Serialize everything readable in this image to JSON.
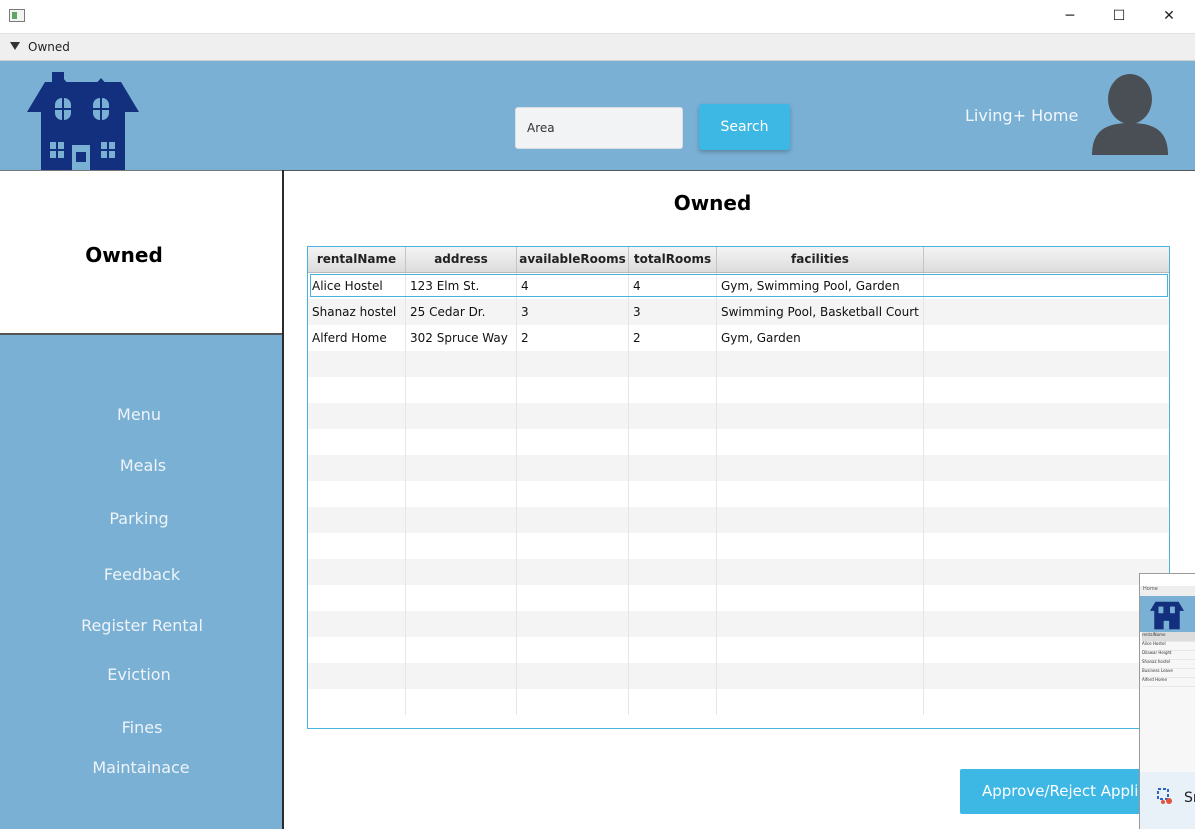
{
  "window": {
    "title": "Owned",
    "controls": {
      "minimize": "─",
      "maximize": "☐",
      "close": "✕"
    }
  },
  "search": {
    "value": "Area",
    "button_label": "Search"
  },
  "brand": "Living+ Home",
  "sidebar": {
    "title": "Owned",
    "items": [
      {
        "label": "Menu"
      },
      {
        "label": "Meals"
      },
      {
        "label": "Parking"
      },
      {
        "label": "Feedback"
      },
      {
        "label": "Register Rental"
      },
      {
        "label": "Eviction"
      },
      {
        "label": "Fines"
      },
      {
        "label": "Maintainace"
      }
    ]
  },
  "main": {
    "title": "Owned",
    "table": {
      "columns": [
        "rentalName",
        "address",
        "availableRooms",
        "totalRooms",
        "facilities"
      ],
      "rows": [
        {
          "rentalName": "Alice Hostel",
          "address": "123 Elm St.",
          "availableRooms": "4",
          "totalRooms": "4",
          "facilities": "Gym, Swimming Pool, Garden"
        },
        {
          "rentalName": "Shanaz hostel",
          "address": "25 Cedar Dr.",
          "availableRooms": "3",
          "totalRooms": "3",
          "facilities": "Swimming Pool, Basketball Court"
        },
        {
          "rentalName": "Alferd Home",
          "address": "302 Spruce Way",
          "availableRooms": "2",
          "totalRooms": "2",
          "facilities": "Gym, Garden"
        }
      ]
    },
    "approve_button": "Approve/Reject Applica"
  },
  "thumbnail": {
    "menu_label": "Home",
    "rows": [
      "rentalName",
      "Alice Hostel",
      "Dilawar Height",
      "Shanaz hostel",
      "Business Leave",
      "Alferd Home"
    ],
    "footer_label": "Sn"
  },
  "colors": {
    "header": "#7ab0d4",
    "accent": "#3db8e5",
    "logo": "#13307f",
    "avatar": "#4a4f55"
  }
}
